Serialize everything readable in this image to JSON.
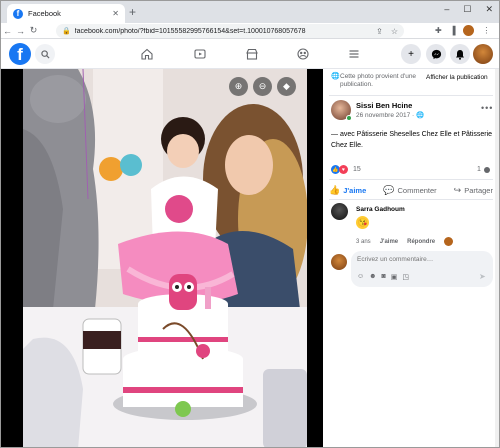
{
  "browser": {
    "tab_title": "Facebook",
    "url_domain": "facebook.com",
    "url_rest": "/photo/?fbid=10155582995766154&set=t.100010768057678",
    "min_glyph": "–",
    "max_glyph": "☐",
    "close_glyph": "✕"
  },
  "panel": {
    "public_notice": "Cette photo provient d'une publication.",
    "public_button": "Afficher la publication",
    "author_name": "Sissi Ben Hcine",
    "post_date": "26 novembre 2017 · ",
    "caption": "— avec Pâtisserie Sheselles Chez Elle et Pâtisserie Chez Elle.",
    "reaction_count": "15",
    "comment_count": "1",
    "actions": {
      "like": "J'aime",
      "comment": "Commenter",
      "share": "Partager"
    },
    "comment": {
      "author": "Sarra Gadhoum",
      "time": "3 ans",
      "like": "J'aime",
      "reply": "Répondre"
    },
    "write_placeholder": "Écrivez un commentaire…"
  },
  "colors": {
    "fb_blue": "#1877f2",
    "love_red": "#f33e58",
    "online_green": "#31a24c"
  },
  "icons": [
    "facebook-logo",
    "search-icon",
    "home-icon",
    "watch-icon",
    "marketplace-icon",
    "groups-icon",
    "menu-icon",
    "plus-icon",
    "messenger-icon",
    "notifications-icon",
    "zoom-in-icon",
    "zoom-out-icon",
    "tag-icon",
    "fullscreen-icon",
    "globe-icon",
    "more-icon",
    "like-icon",
    "comment-icon",
    "share-icon",
    "send-icon"
  ]
}
